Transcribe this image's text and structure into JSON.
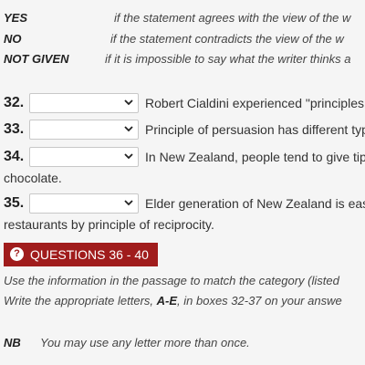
{
  "legend": [
    {
      "term": "YES",
      "desc": "if the statement agrees with the view of the w"
    },
    {
      "term": "NO",
      "desc": "if the statement contradicts the view of the w"
    },
    {
      "term": "NOT GIVEN",
      "desc": "if it is impossible to say what the writer thinks a"
    }
  ],
  "questions": [
    {
      "num": "32.",
      "text": "Robert Cialdini experienced \"principles",
      "cont": ""
    },
    {
      "num": "33.",
      "text": "Principle of persuasion has different typ",
      "cont": ""
    },
    {
      "num": "34.",
      "text": "In New Zealand, people tend to give tip",
      "cont": "chocolate."
    },
    {
      "num": "35.",
      "text": "Elder generation of New Zealand is eas",
      "cont": "restaurants by principle of reciprocity."
    }
  ],
  "section": {
    "icon": "question-circle-icon",
    "title": "QUESTIONS 36 - 40",
    "color": "#a01c1c"
  },
  "instructions": {
    "line1": "Use the information in the passage to match the category (listed",
    "line2_before": "Write the appropriate letters, ",
    "line2_bold": "A-E",
    "line2_after": ", in boxes 32-37 on your answe"
  },
  "nb": {
    "term": "NB",
    "text": "You may use any letter more than once."
  }
}
